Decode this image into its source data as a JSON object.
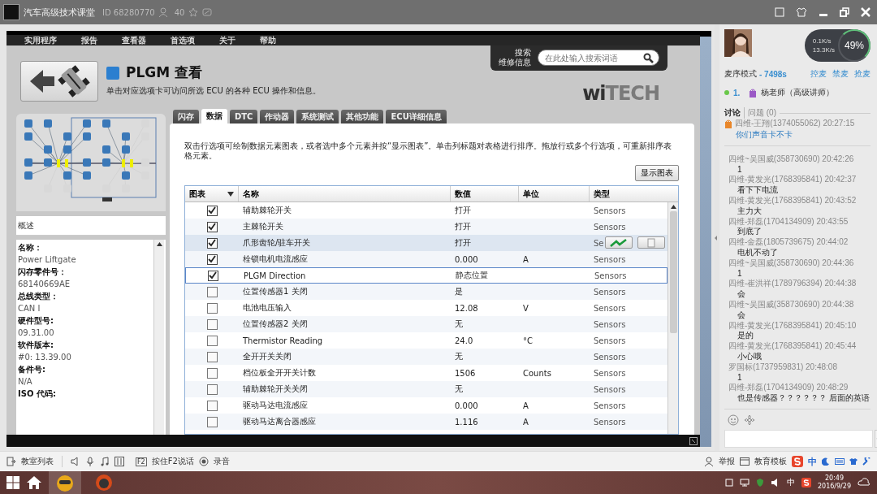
{
  "app_header": {
    "title": "汽车高级技术课堂",
    "room_id": "ID 68280770",
    "member_count": "40"
  },
  "witech": {
    "menu": [
      "实用程序",
      "报告",
      "查看器",
      "首选项",
      "关于",
      "帮助"
    ],
    "search": {
      "label_lines": [
        "搜索",
        "维修信息"
      ],
      "placeholder": "在此处输入搜索词语"
    },
    "logo": {
      "strong": "wi",
      "faded": "TECH"
    },
    "view_title": "PLGM 查看",
    "view_description": "单击对应选项卡可访问所选 ECU 的各种 ECU 操作和信息。",
    "overview_label": "概述",
    "details": [
      {
        "label": "名称：",
        "value": "Power Liftgate"
      },
      {
        "label": "闪存零件号：",
        "value": "68140669AE"
      },
      {
        "label": "总线类型：",
        "value": "CAN I"
      },
      {
        "label": "硬件型号:",
        "value": "09.31.00"
      },
      {
        "label": "软件版本:",
        "value": "#0: 13.39.00"
      },
      {
        "label": "备件号:",
        "value": "N/A"
      },
      {
        "label": "ISO 代码:"
      }
    ],
    "tabs": [
      {
        "label": "闪存",
        "selected": false
      },
      {
        "label": "数据",
        "selected": true
      },
      {
        "label": "DTC",
        "selected": false
      },
      {
        "label": "作动器",
        "selected": false
      },
      {
        "label": "系统测试",
        "selected": false
      },
      {
        "label": "其他功能",
        "selected": false
      },
      {
        "label": "ECU详细信息",
        "selected": false
      }
    ],
    "instructions": "双击行选项可绘制数据元素图表，或者选中多个元素并按“显示图表”。单击列标题对表格进行排序。拖放行或多个行选项，可重新排序表格元素。",
    "chart_button": "显示图表",
    "table": {
      "columns": [
        "图表",
        "名称",
        "数值",
        "单位",
        "类型"
      ],
      "rows": [
        {
          "checked": true,
          "selected": false,
          "hovered": false,
          "name": "辅助棘轮开关",
          "value": "打开",
          "unit": "",
          "type": "Sensors"
        },
        {
          "checked": true,
          "selected": false,
          "hovered": false,
          "name": "主棘轮开关",
          "value": "打开",
          "unit": "",
          "type": "Sensors"
        },
        {
          "checked": true,
          "selected": false,
          "hovered": true,
          "name": "爪形齿轮/驻车开关",
          "value": "打开",
          "unit": "",
          "type": "Se"
        },
        {
          "checked": true,
          "selected": false,
          "hovered": false,
          "name": "栓锁电机电流感应",
          "value": "0.000",
          "unit": "A",
          "type": "Sensors"
        },
        {
          "checked": true,
          "selected": true,
          "hovered": false,
          "name": "PLGM Direction",
          "value": "静态位置",
          "unit": "",
          "type": "Sensors"
        },
        {
          "checked": false,
          "selected": false,
          "hovered": false,
          "name": "位置传感器1 关闭",
          "value": "是",
          "unit": "",
          "type": "Sensors"
        },
        {
          "checked": false,
          "selected": false,
          "hovered": false,
          "name": "电池电压输入",
          "value": "12.08",
          "unit": "V",
          "type": "Sensors"
        },
        {
          "checked": false,
          "selected": false,
          "hovered": false,
          "name": "位置传感器2 关闭",
          "value": "无",
          "unit": "",
          "type": "Sensors"
        },
        {
          "checked": false,
          "selected": false,
          "hovered": false,
          "name": "Thermistor Reading",
          "value": "24.0",
          "unit": "°C",
          "type": "Sensors"
        },
        {
          "checked": false,
          "selected": false,
          "hovered": false,
          "name": "全开开关关闭",
          "value": "无",
          "unit": "",
          "type": "Sensors"
        },
        {
          "checked": false,
          "selected": false,
          "hovered": false,
          "name": "档位板全开开关计数",
          "value": "1506",
          "unit": "Counts",
          "type": "Sensors"
        },
        {
          "checked": false,
          "selected": false,
          "hovered": false,
          "name": "辅助棘轮开关关闭",
          "value": "无",
          "unit": "",
          "type": "Sensors"
        },
        {
          "checked": false,
          "selected": false,
          "hovered": false,
          "name": "驱动马达电流感应",
          "value": "0.000",
          "unit": "A",
          "type": "Sensors"
        },
        {
          "checked": false,
          "selected": false,
          "hovered": false,
          "name": "驱动马达离合器感应",
          "value": "1.116",
          "unit": "A",
          "type": "Sensors"
        }
      ]
    }
  },
  "sidebar": {
    "net": {
      "upload": "0.1K/s",
      "download": "13.3K/s",
      "usage": "49%"
    },
    "mic_mode": "麦序模式",
    "countdown": "- 7498s",
    "mic_actions": [
      "控麦",
      "禁麦",
      "抢麦"
    ],
    "queue": [
      {
        "rank": "1.",
        "name": "杨老师（高级讲师）"
      }
    ],
    "chat_tabs": [
      {
        "label": "讨论",
        "selected": true
      },
      {
        "label": "问题 (0)",
        "selected": false
      }
    ],
    "pinned": {
      "header": "四维-王翔(1374055062) 20:27:15",
      "text": "你们声音卡不卡"
    },
    "messages": [
      {
        "header": "四维~吴国威(358730690) 20:42:26",
        "text": "1"
      },
      {
        "header": "四维-黄发光(1768395841) 20:42:37",
        "text": "看下下电流"
      },
      {
        "header": "四维-黄发光(1768395841) 20:43:52",
        "text": "主力大"
      },
      {
        "header": "四维-郑磊(1704134909) 20:43:55",
        "text": "到底了"
      },
      {
        "header": "四维-金磊(1805739675) 20:44:02",
        "text": "电机不动了"
      },
      {
        "header": "四维~吴国威(358730690) 20:44:36",
        "text": "1"
      },
      {
        "header": "四维-崔洪祥(1789796394) 20:44:38",
        "text": "会"
      },
      {
        "header": "四维~吴国威(358730690) 20:44:38",
        "text": "会"
      },
      {
        "header": "四维-黄发光(1768395841) 20:45:10",
        "text": "是的"
      },
      {
        "header": "四维-黄发光(1768395841) 20:45:44",
        "text": "小心哦"
      },
      {
        "header": "罗国标(1737959831) 20:48:08",
        "text": "1"
      },
      {
        "header": "四维-郑磊(1704134909) 20:48:29",
        "text": "也是传感器？？？？？？ 后面的英语"
      }
    ]
  },
  "toolbar": {
    "classroom_list": "教室列表",
    "ptt_key": "F2",
    "push_to_talk": "按住F2说话",
    "record": "录音",
    "report": "举报",
    "template": "教育模板",
    "ime": "中"
  },
  "taskbar": {
    "ime": "中",
    "time": "20:49",
    "date": "2016/9/29"
  }
}
